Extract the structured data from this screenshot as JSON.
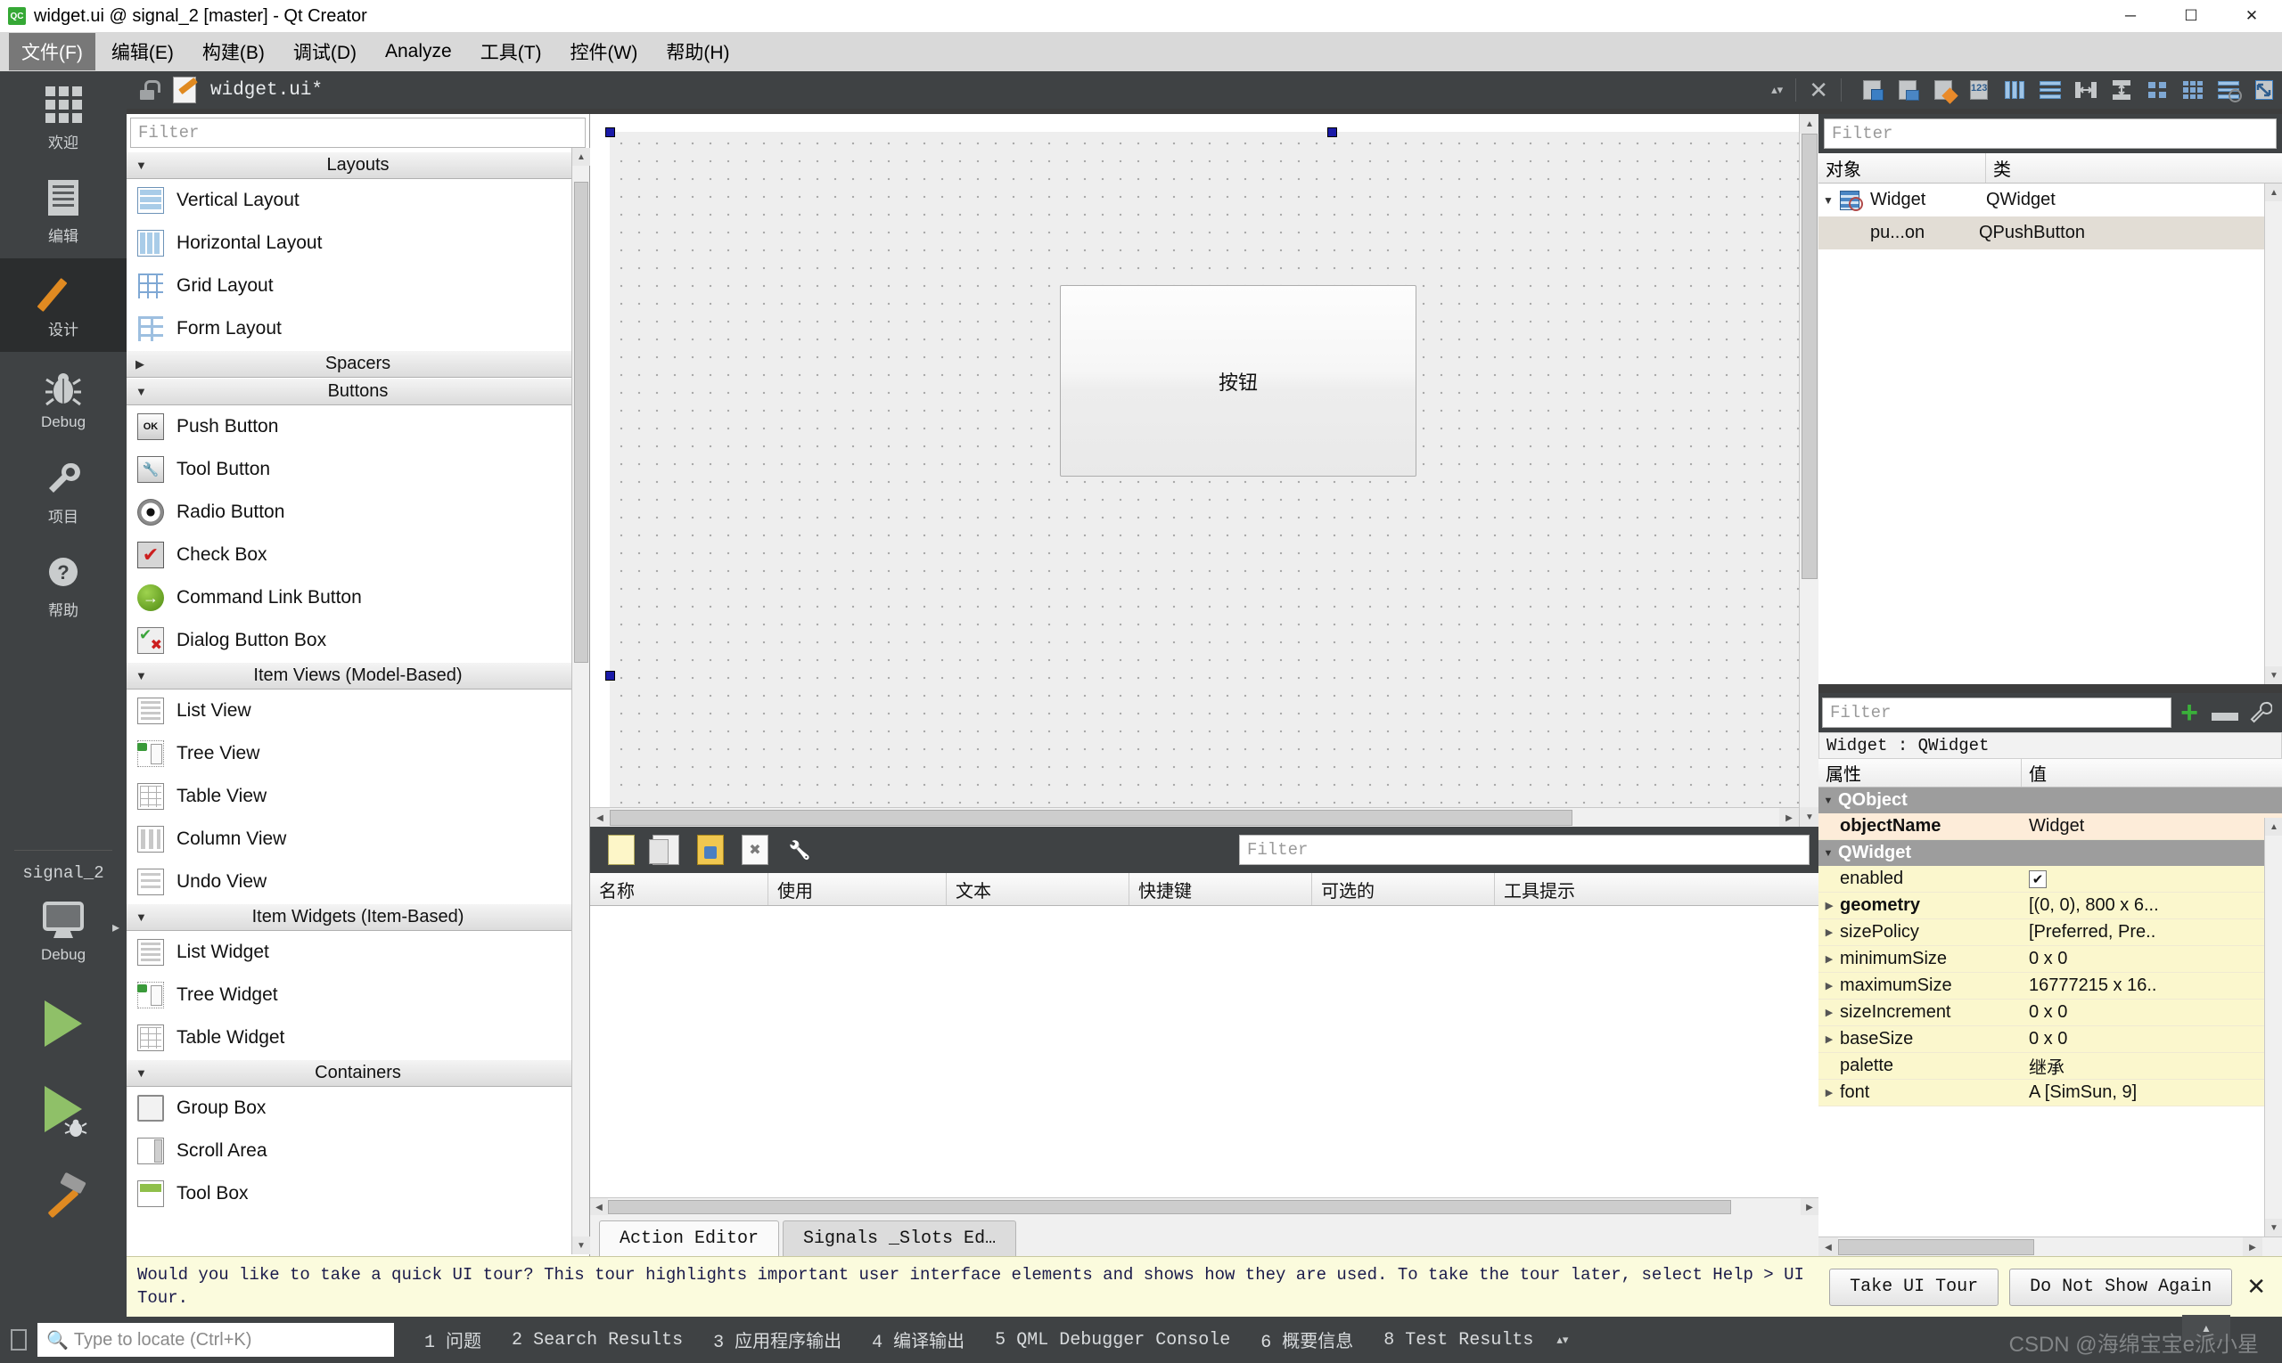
{
  "titlebar": {
    "icon": "qt-creator-icon",
    "title": "widget.ui @ signal_2 [master] - Qt Creator",
    "minimize": "─",
    "maximize": "☐",
    "close": "✕"
  },
  "menubar": {
    "items": [
      {
        "label": "文件(F)",
        "active": true
      },
      {
        "label": "编辑(E)",
        "active": false
      },
      {
        "label": "构建(B)",
        "active": false
      },
      {
        "label": "调试(D)",
        "active": false
      },
      {
        "label": "Analyze",
        "active": false
      },
      {
        "label": "工具(T)",
        "active": false
      },
      {
        "label": "控件(W)",
        "active": false
      },
      {
        "label": "帮助(H)",
        "active": false
      }
    ]
  },
  "modebar": {
    "items": [
      {
        "label": "欢迎",
        "icon": "grid-icon",
        "selected": false
      },
      {
        "label": "编辑",
        "icon": "document-icon",
        "selected": false
      },
      {
        "label": "设计",
        "icon": "pencil-icon",
        "selected": true
      },
      {
        "label": "Debug",
        "icon": "bug-icon",
        "selected": false
      },
      {
        "label": "项目",
        "icon": "wrench-icon",
        "selected": false
      },
      {
        "label": "帮助",
        "icon": "help-icon",
        "selected": false
      }
    ],
    "kit": {
      "project": "signal_2",
      "config": "Debug",
      "icon": "monitor-icon",
      "chevron": "▸"
    },
    "actions": [
      {
        "name": "run-button",
        "icon": "play-icon"
      },
      {
        "name": "debug-button",
        "icon": "play-bug-icon"
      },
      {
        "name": "build-button",
        "icon": "hammer-icon"
      }
    ]
  },
  "designer_toolbar": {
    "lock_icon": "lock-open-icon",
    "file_icon": "ui-file-icon",
    "file_name": "widget.ui*",
    "spinner": "▴▾",
    "close": "✕",
    "tools": [
      "edit-widgets-icon",
      "edit-signals-slots-icon",
      "edit-buddies-icon",
      "edit-tab-order-icon",
      "layout-horizontally-icon",
      "layout-vertically-icon",
      "layout-horizontal-splitter-icon",
      "layout-vertical-splitter-icon",
      "layout-form-icon",
      "layout-grid-icon",
      "break-layout-icon",
      "adjust-size-icon"
    ]
  },
  "widget_box": {
    "filter_placeholder": "Filter",
    "groups": [
      {
        "title": "Layouts",
        "expanded": true,
        "items": [
          {
            "label": "Vertical Layout",
            "icon": "vertical-layout-icon"
          },
          {
            "label": "Horizontal Layout",
            "icon": "horizontal-layout-icon"
          },
          {
            "label": "Grid Layout",
            "icon": "grid-layout-icon"
          },
          {
            "label": "Form Layout",
            "icon": "form-layout-icon"
          }
        ]
      },
      {
        "title": "Spacers",
        "expanded": false,
        "items": []
      },
      {
        "title": "Buttons",
        "expanded": true,
        "items": [
          {
            "label": "Push Button",
            "icon": "push-button-icon"
          },
          {
            "label": "Tool Button",
            "icon": "tool-button-icon"
          },
          {
            "label": "Radio Button",
            "icon": "radio-button-icon"
          },
          {
            "label": "Check Box",
            "icon": "check-box-icon"
          },
          {
            "label": "Command Link Button",
            "icon": "command-link-icon"
          },
          {
            "label": "Dialog Button Box",
            "icon": "dialog-button-box-icon"
          }
        ]
      },
      {
        "title": "Item Views (Model-Based)",
        "expanded": true,
        "items": [
          {
            "label": "List View",
            "icon": "list-view-icon"
          },
          {
            "label": "Tree View",
            "icon": "tree-view-icon"
          },
          {
            "label": "Table View",
            "icon": "table-view-icon"
          },
          {
            "label": "Column View",
            "icon": "column-view-icon"
          },
          {
            "label": "Undo View",
            "icon": "undo-view-icon"
          }
        ]
      },
      {
        "title": "Item Widgets (Item-Based)",
        "expanded": true,
        "items": [
          {
            "label": "List Widget",
            "icon": "list-widget-icon"
          },
          {
            "label": "Tree Widget",
            "icon": "tree-widget-icon"
          },
          {
            "label": "Table Widget",
            "icon": "table-widget-icon"
          }
        ]
      },
      {
        "title": "Containers",
        "expanded": true,
        "items": [
          {
            "label": "Group Box",
            "icon": "group-box-icon"
          },
          {
            "label": "Scroll Area",
            "icon": "scroll-area-icon"
          },
          {
            "label": "Tool Box",
            "icon": "tool-box-icon"
          }
        ]
      }
    ]
  },
  "form_canvas": {
    "button_text": "按钮",
    "selection_handles": 3
  },
  "action_editor": {
    "toolbar_icons": [
      "new-action-icon",
      "copy-icon",
      "paste-icon",
      "delete-icon",
      "configure-icon"
    ],
    "filter_placeholder": "Filter",
    "columns": [
      "名称",
      "使用",
      "文本",
      "快捷键",
      "可选的",
      "工具提示"
    ],
    "rows": [],
    "tabs": [
      {
        "label": "Action Editor",
        "selected": true
      },
      {
        "label": "Signals _Slots Ed…",
        "selected": false
      }
    ]
  },
  "object_inspector": {
    "filter_placeholder": "Filter",
    "columns": [
      "对象",
      "类"
    ],
    "rows": [
      {
        "object": "Widget",
        "class": "QWidget",
        "indent": 0,
        "expanded": true,
        "selected": false,
        "icon": "widget-icon"
      },
      {
        "object": "pu...on",
        "class": "QPushButton",
        "indent": 1,
        "expanded": false,
        "selected": true,
        "icon": ""
      }
    ]
  },
  "property_editor": {
    "filter_placeholder": "Filter",
    "add_label": "+",
    "remove_label": "—",
    "configure_label": "ὒ7",
    "object_title": "Widget : QWidget",
    "columns": [
      "属性",
      "值"
    ],
    "rows": [
      {
        "kind": "group",
        "name": "QObject",
        "value": "",
        "expandable": true,
        "expanded": true
      },
      {
        "kind": "prop",
        "name": "objectName",
        "value": "Widget",
        "bold": true,
        "tint": "cream",
        "expandable": false
      },
      {
        "kind": "group",
        "name": "QWidget",
        "value": "",
        "expandable": true,
        "expanded": true
      },
      {
        "kind": "prop",
        "name": "enabled",
        "value": "✔",
        "valueType": "checkbox",
        "tint": "yellow",
        "expandable": false
      },
      {
        "kind": "prop",
        "name": "geometry",
        "value": "[(0, 0), 800 x 6...",
        "bold": true,
        "tint": "yellow",
        "expandable": true
      },
      {
        "kind": "prop",
        "name": "sizePolicy",
        "value": "[Preferred, Pre..",
        "tint": "yellow",
        "expandable": true
      },
      {
        "kind": "prop",
        "name": "minimumSize",
        "value": "0 x 0",
        "tint": "yellow",
        "expandable": true
      },
      {
        "kind": "prop",
        "name": "maximumSize",
        "value": "16777215 x 16..",
        "tint": "yellow",
        "expandable": true
      },
      {
        "kind": "prop",
        "name": "sizeIncrement",
        "value": "0 x 0",
        "tint": "yellow",
        "expandable": true
      },
      {
        "kind": "prop",
        "name": "baseSize",
        "value": "0 x 0",
        "tint": "yellow",
        "expandable": true
      },
      {
        "kind": "prop",
        "name": "palette",
        "value": "继承",
        "tint": "yellow",
        "expandable": false
      },
      {
        "kind": "prop",
        "name": "font",
        "value": "A   [SimSun, 9]",
        "tint": "yellow",
        "expandable": true
      }
    ]
  },
  "notification": {
    "text": "Would you like to take a quick UI tour? This tour highlights important user interface elements and shows how they are used. To take the tour later, select Help > UI Tour.",
    "primary_button": "Take UI Tour",
    "secondary_button": "Do Not Show Again",
    "close": "✕"
  },
  "statusbar": {
    "toggle_sidebar_icon": "sidebar-toggle-icon",
    "locate_placeholder": "Type to locate (Ctrl+K)",
    "search_icon": "search-icon",
    "panes": [
      {
        "num": "1",
        "label": "问题",
        "cjk": true
      },
      {
        "num": "2",
        "label": "Search Results",
        "cjk": false
      },
      {
        "num": "3",
        "label": "应用程序输出",
        "cjk": true
      },
      {
        "num": "4",
        "label": "编译输出",
        "cjk": true
      },
      {
        "num": "5",
        "label": "QML Debugger Console",
        "cjk": false
      },
      {
        "num": "6",
        "label": "概要信息",
        "cjk": true
      },
      {
        "num": "8",
        "label": "Test Results",
        "cjk": false
      }
    ],
    "spinner": "▴▾",
    "watermark": "CSDN @海绵宝宝e派小星"
  }
}
